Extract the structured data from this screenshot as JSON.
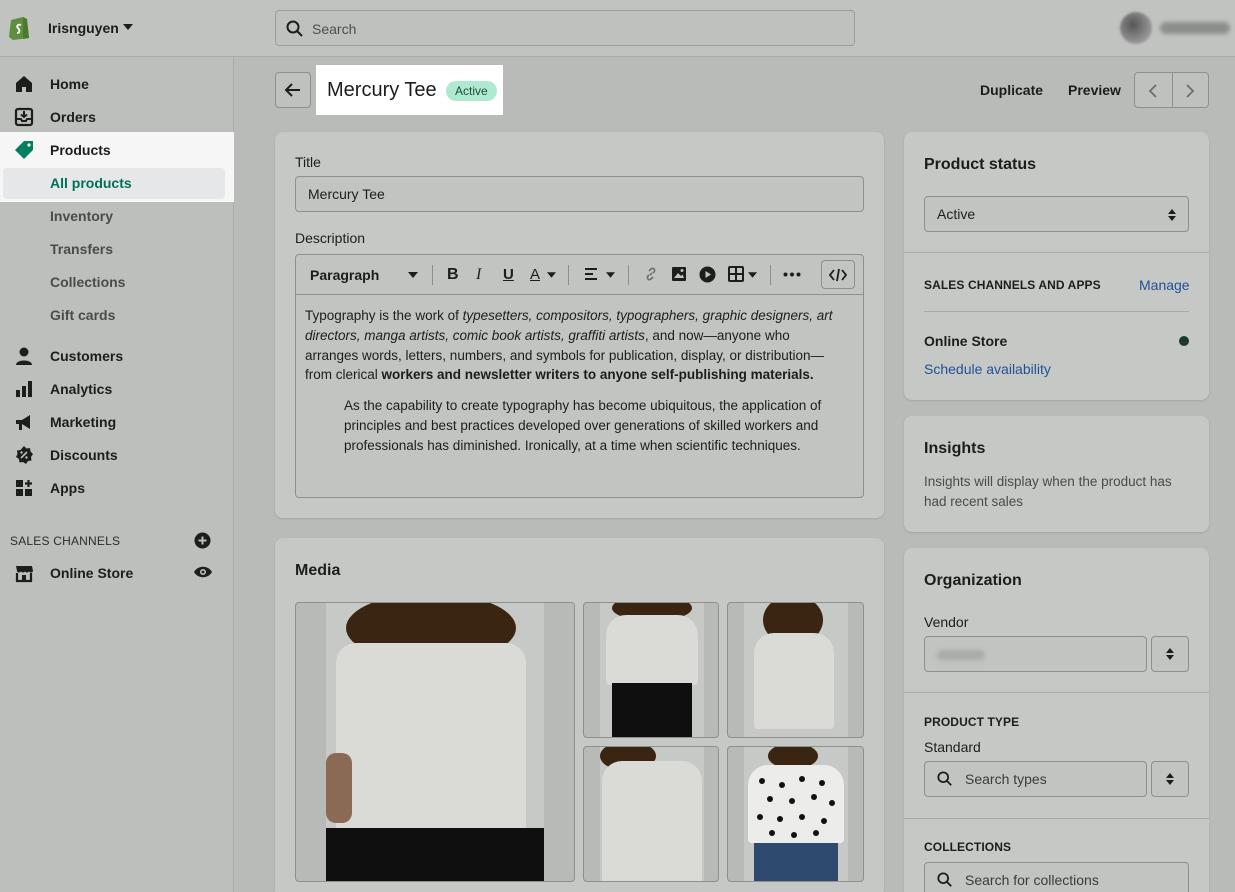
{
  "store": {
    "name": "Irisnguyen"
  },
  "search": {
    "placeholder": "Search"
  },
  "nav": {
    "home": "Home",
    "orders": "Orders",
    "products": "Products",
    "all_products": "All products",
    "inventory": "Inventory",
    "transfers": "Transfers",
    "collections": "Collections",
    "gift_cards": "Gift cards",
    "customers": "Customers",
    "analytics": "Analytics",
    "marketing": "Marketing",
    "discounts": "Discounts",
    "apps": "Apps",
    "sales_channels_title": "SALES CHANNELS",
    "online_store": "Online Store"
  },
  "header": {
    "title": "Mercury Tee",
    "status_badge": "Active",
    "duplicate": "Duplicate",
    "preview": "Preview"
  },
  "product": {
    "title_label": "Title",
    "title_value": "Mercury Tee",
    "description_label": "Description",
    "paragraph_select": "Paragraph",
    "desc1_a": "Typography is the work of ",
    "desc1_italic": "typesetters, compositors, typographers, graphic designers, art directors, manga artists, comic book artists, graffiti artists",
    "desc1_b": ", and now—anyone who arranges words, letters, numbers, and symbols for publication, display, or distribution—from clerical ",
    "desc1_bold": "workers and newsletter writers to anyone self-publishing materials.",
    "desc2": "As the capability to create typography has become ubiquitous, the application of principles and best practices developed over generations of skilled workers and professionals has diminished. Ironically, at a time when scientific techniques."
  },
  "media": {
    "title": "Media"
  },
  "status_card": {
    "title": "Product status",
    "value": "Active",
    "sales_channels_title": "SALES CHANNELS AND APPS",
    "manage": "Manage",
    "online_store": "Online Store",
    "schedule": "Schedule availability",
    "dot_color": "#1a3b2c"
  },
  "insights": {
    "title": "Insights",
    "text": "Insights will display when the product has had recent sales"
  },
  "organization": {
    "title": "Organization",
    "vendor_label": "Vendor",
    "product_type_title": "PRODUCT TYPE",
    "product_type_value": "Standard",
    "search_types_placeholder": "Search types",
    "collections_title": "COLLECTIONS",
    "search_collections_placeholder": "Search for collections"
  },
  "colors": {
    "accent_green": "#008060",
    "badge_bg": "#aee9d1",
    "link": "#1f5199"
  }
}
